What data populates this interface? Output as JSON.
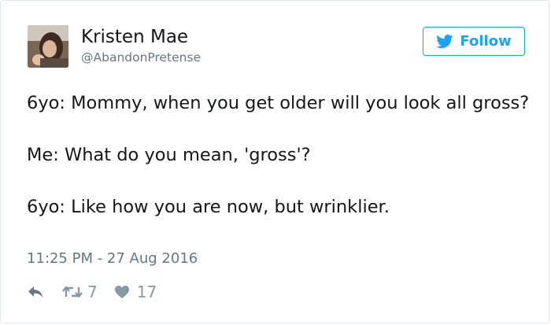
{
  "author": {
    "name": "Kristen Mae",
    "handle": "@AbandonPretense",
    "avatar_icon": "profile-photo"
  },
  "follow_button": {
    "label": "Follow",
    "icon": "twitter-bird-icon",
    "color": "#1da1f2"
  },
  "tweet": {
    "lines": [
      "6yo: Mommy, when you get older will you look all gross?",
      "Me: What do you mean, 'gross'?",
      "6yo: Like how you are now, but wrinklier."
    ],
    "timestamp": "11:25 PM - 27 Aug 2016"
  },
  "actions": {
    "reply_icon": "reply-icon",
    "retweet_icon": "retweet-icon",
    "retweet_count": "7",
    "like_icon": "heart-icon",
    "like_count": "17"
  },
  "colors": {
    "text": "#14171a",
    "secondary_text": "#657786",
    "icon_gray": "#8899a6",
    "border": "#e1e8ed"
  }
}
